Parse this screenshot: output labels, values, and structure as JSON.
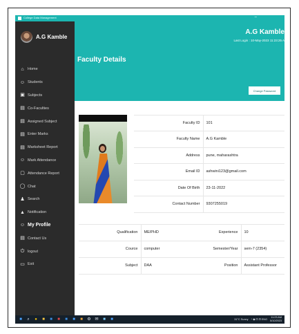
{
  "window": {
    "title": "College Data Management",
    "minimize_glyph": "–"
  },
  "sidebar": {
    "user_name": "A.G Kamble",
    "items": [
      {
        "label": "Home",
        "icon": "home-icon",
        "glyph": "⌂"
      },
      {
        "label": "Students",
        "icon": "students-icon",
        "glyph": "☺"
      },
      {
        "label": "Subjects",
        "icon": "subjects-icon",
        "glyph": "▣"
      },
      {
        "label": "Co-Faculties",
        "icon": "faculties-icon",
        "glyph": "▤"
      },
      {
        "label": "Assigned Subject",
        "icon": "assigned-subject-icon",
        "glyph": "▤"
      },
      {
        "label": "Enter Marks",
        "icon": "marks-icon",
        "glyph": "▤"
      },
      {
        "label": "Marksheet Report",
        "icon": "marksheet-icon",
        "glyph": "▤"
      },
      {
        "label": "Mark Attendance",
        "icon": "attendance-icon",
        "glyph": "☺"
      },
      {
        "label": "Attendance Report",
        "icon": "report-icon",
        "glyph": "▢"
      },
      {
        "label": "Chat",
        "icon": "chat-icon",
        "glyph": "◯"
      },
      {
        "label": "Search",
        "icon": "search-icon",
        "glyph": "♟"
      },
      {
        "label": "Notification",
        "icon": "notification-icon",
        "glyph": "▲"
      },
      {
        "label": "My Profile",
        "icon": "profile-icon",
        "glyph": "☺"
      },
      {
        "label": "Contact Us",
        "icon": "contact-icon",
        "glyph": "▤"
      },
      {
        "label": "logout",
        "icon": "logout-icon",
        "glyph": "⏻"
      },
      {
        "label": "Exit",
        "icon": "exit-icon",
        "glyph": "▭"
      }
    ]
  },
  "header": {
    "name": "A.G Kamble",
    "last_login": "Last Login : 10-May-2023 11:23:25 A",
    "page_title": "Faculty Details",
    "change_password_label": "Change Password"
  },
  "details": [
    {
      "label": "Faculty ID",
      "value": "101"
    },
    {
      "label": "Faculty Name",
      "value": "A.G Kamble"
    },
    {
      "label": "Address",
      "value": "pune, maharashtra"
    },
    {
      "label": "Email ID",
      "value": "ashwini123@gmail.com"
    },
    {
      "label": "Date Of Birth",
      "value": "23-11-2022"
    },
    {
      "label": "Contact Number",
      "value": "9307255019"
    }
  ],
  "extra": [
    {
      "label1": "Qualification",
      "value1": "ME/PHD",
      "label2": "Experience",
      "value2": "10"
    },
    {
      "label1": "Cource",
      "value1": "computer",
      "label2": "Semester/Year",
      "value2": "sem-7  (2354)"
    },
    {
      "label1": "Subject",
      "value1": "DAA",
      "label2": "Position",
      "value2": "Assistant Professor"
    }
  ],
  "taskbar": {
    "weather": "31°C  Sunny",
    "tray": "^ ◆ ⊡ ⊡ ENG",
    "time": "11:23 AM",
    "date": "5/10/2023",
    "icons": [
      {
        "name": "windows-start-icon",
        "glyph": "■",
        "color": "#4aa3ff"
      },
      {
        "name": "search-icon",
        "glyph": "⌕",
        "color": "#dfe6ee"
      },
      {
        "name": "chrome-icon",
        "glyph": "●",
        "color": "#f4c20d"
      },
      {
        "name": "file-explorer-icon",
        "glyph": "■",
        "color": "#f5c542"
      },
      {
        "name": "app-icon",
        "glyph": "■",
        "color": "#3b8de0"
      },
      {
        "name": "app-icon",
        "glyph": "■",
        "color": "#e04848"
      },
      {
        "name": "app-icon",
        "glyph": "■",
        "color": "#3b8de0"
      },
      {
        "name": "app-icon",
        "glyph": "■",
        "color": "#4aa3ff"
      },
      {
        "name": "app-icon",
        "glyph": "■",
        "color": "#e9a23b"
      },
      {
        "name": "settings-icon",
        "glyph": "⚙",
        "color": "#dfe6ee"
      },
      {
        "name": "mail-icon",
        "glyph": "✉",
        "color": "#dfe6ee"
      },
      {
        "name": "app-icon",
        "glyph": "■",
        "color": "#7fd0ff"
      },
      {
        "name": "app-icon",
        "glyph": "■",
        "color": "#4aa3ff"
      }
    ]
  },
  "colors": {
    "accent": "#1cb5b0",
    "sidebar": "#2b2b2b",
    "taskbar": "#15202b"
  }
}
